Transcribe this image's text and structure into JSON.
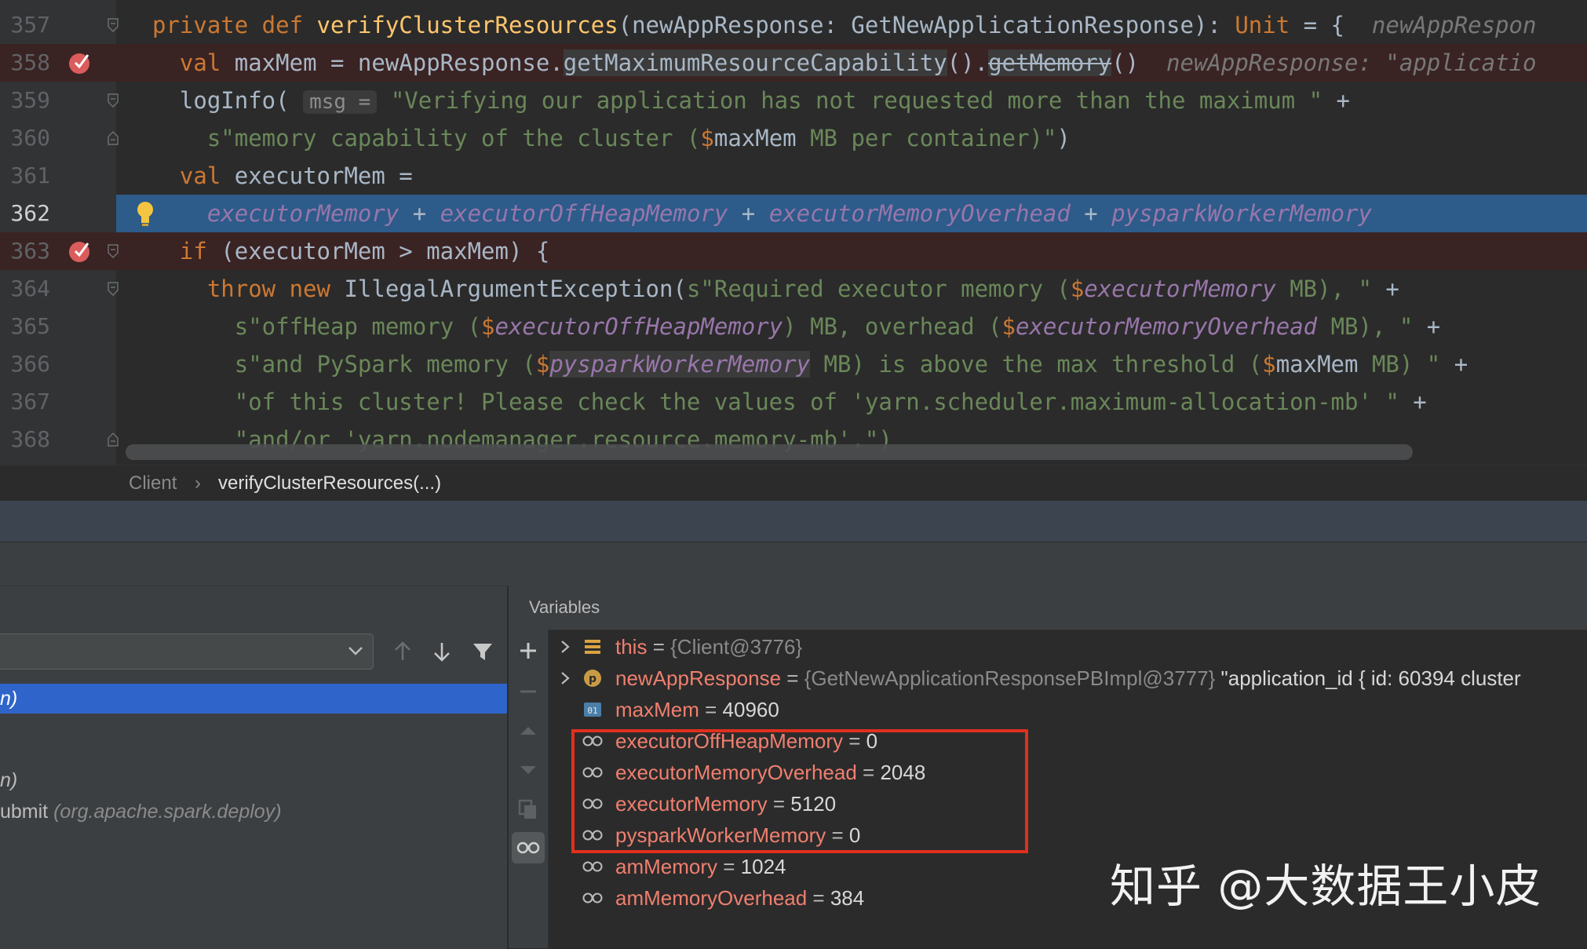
{
  "editor": {
    "lines": [
      {
        "num": "357",
        "parts": [
          {
            "t": "private def ",
            "c": "kw"
          },
          {
            "t": "verifyClusterResources",
            "c": "fn"
          },
          {
            "t": "(newAppResponse: GetNewApplicationResponse): "
          },
          {
            "t": "Unit",
            "c": "kw"
          },
          {
            "t": " = {  "
          },
          {
            "t": "newAppRespon",
            "c": "hint"
          }
        ]
      },
      {
        "num": "358",
        "parts": [
          {
            "t": "  "
          },
          {
            "t": "val ",
            "c": "kw"
          },
          {
            "t": "maxMem = newAppResponse."
          },
          {
            "t": "getMaximumResourceCapability",
            "c": "hl"
          },
          {
            "t": "()."
          },
          {
            "t": "getMemory",
            "c": "hl strike"
          },
          {
            "t": "()  "
          },
          {
            "t": "newAppResponse: \"applicatio",
            "c": "hint"
          }
        ]
      },
      {
        "num": "359",
        "parts": [
          {
            "t": "  logInfo( "
          },
          {
            "t": "msg =",
            "c": "param-hint"
          },
          {
            "t": " "
          },
          {
            "t": "\"Verifying our application has not requested more than the maximum \"",
            "c": "str"
          },
          {
            "t": " +"
          }
        ]
      },
      {
        "num": "360",
        "parts": [
          {
            "t": "    "
          },
          {
            "t": "s\"memory capability of the cluster (",
            "c": "str"
          },
          {
            "t": "$",
            "c": "dollar"
          },
          {
            "t": "maxMem"
          },
          {
            "t": " MB per container)\"",
            "c": "str"
          },
          {
            "t": ")"
          }
        ]
      },
      {
        "num": "361",
        "parts": [
          {
            "t": "  "
          },
          {
            "t": "val ",
            "c": "kw"
          },
          {
            "t": "executorMem ="
          }
        ]
      },
      {
        "num": "362",
        "parts": [
          {
            "t": "    "
          },
          {
            "t": "executorMemory",
            "c": "ivar"
          },
          {
            "t": " + "
          },
          {
            "t": "executorOffHeapMemory",
            "c": "ivar"
          },
          {
            "t": " + "
          },
          {
            "t": "executorMemoryOverhead",
            "c": "ivar"
          },
          {
            "t": " + "
          },
          {
            "t": "pysparkWorkerMemory",
            "c": "ivar"
          }
        ]
      },
      {
        "num": "363",
        "parts": [
          {
            "t": "  "
          },
          {
            "t": "if ",
            "c": "kw"
          },
          {
            "t": "(executorMem > maxMem) {"
          }
        ]
      },
      {
        "num": "364",
        "parts": [
          {
            "t": "    "
          },
          {
            "t": "throw new ",
            "c": "kw"
          },
          {
            "t": "IllegalArgumentException("
          },
          {
            "t": "s\"Required executor memory (",
            "c": "str"
          },
          {
            "t": "$",
            "c": "dollar"
          },
          {
            "t": "executorMemory",
            "c": "ivar"
          },
          {
            "t": " MB), \"",
            "c": "str"
          },
          {
            "t": " +"
          }
        ]
      },
      {
        "num": "365",
        "parts": [
          {
            "t": "      "
          },
          {
            "t": "s\"offHeap memory (",
            "c": "str"
          },
          {
            "t": "$",
            "c": "dollar"
          },
          {
            "t": "executorOffHeapMemory",
            "c": "ivar"
          },
          {
            "t": ") MB, overhead (",
            "c": "str"
          },
          {
            "t": "$",
            "c": "dollar"
          },
          {
            "t": "executorMemoryOverhead",
            "c": "ivar"
          },
          {
            "t": " MB), \"",
            "c": "str"
          },
          {
            "t": " +"
          }
        ]
      },
      {
        "num": "366",
        "parts": [
          {
            "t": "      "
          },
          {
            "t": "s\"and PySpark memory (",
            "c": "str"
          },
          {
            "t": "$",
            "c": "dollar"
          },
          {
            "t": "pysparkWorkerMemory",
            "c": "ivar hl"
          },
          {
            "t": " MB) is above the max threshold (",
            "c": "str"
          },
          {
            "t": "$",
            "c": "dollar"
          },
          {
            "t": "maxMem"
          },
          {
            "t": " MB) \"",
            "c": "str"
          },
          {
            "t": " +"
          }
        ]
      },
      {
        "num": "367",
        "parts": [
          {
            "t": "      "
          },
          {
            "t": "\"of this cluster! Please check the values of 'yarn.scheduler.maximum-allocation-mb' \"",
            "c": "str"
          },
          {
            "t": " +"
          }
        ]
      },
      {
        "num": "368",
        "parts": [
          {
            "t": "      "
          },
          {
            "t": "\"and/or 'yarn.nodemanager.resource.memory-mb'.\")",
            "c": "str"
          }
        ]
      }
    ]
  },
  "breadcrumb": {
    "first": "Client",
    "separator": "›",
    "second": "verifyClusterResources(...)"
  },
  "frames": {
    "items": [
      {
        "text": "n)",
        "pkg": "",
        "selected": true
      },
      {
        "text": "n)",
        "pkg": "",
        "selected": false
      },
      {
        "text": "ubmit ",
        "pkg": "(org.apache.spark.deploy)",
        "selected": false
      }
    ]
  },
  "variables": {
    "title": "Variables",
    "items": [
      {
        "name": "this",
        "eq": " = ",
        "value": "{Client@3776}",
        "valueStyle": "obj",
        "icon": "field-icon",
        "expandable": true
      },
      {
        "name": "newAppResponse",
        "eq": " = ",
        "value": "{GetNewApplicationResponsePBImpl@3777}",
        "valueStyle": "obj",
        "extra": " \"application_id { id: 60394 cluster",
        "icon": "parameter-icon",
        "expandable": true
      },
      {
        "name": "maxMem",
        "eq": " = ",
        "value": "40960",
        "valueStyle": "val",
        "icon": "primitive-icon",
        "expandable": false
      },
      {
        "name": "executorOffHeapMemory",
        "eq": " = ",
        "value": "0",
        "valueStyle": "val",
        "icon": "watch-icon",
        "expandable": false
      },
      {
        "name": "executorMemoryOverhead",
        "eq": " = ",
        "value": "2048",
        "valueStyle": "val",
        "icon": "watch-icon",
        "expandable": false
      },
      {
        "name": "executorMemory",
        "eq": " = ",
        "value": "5120",
        "valueStyle": "val",
        "icon": "watch-icon",
        "expandable": false
      },
      {
        "name": "pysparkWorkerMemory",
        "eq": " = ",
        "value": "0",
        "valueStyle": "val",
        "icon": "watch-icon",
        "expandable": false
      },
      {
        "name": "amMemory",
        "eq": " = ",
        "value": "1024",
        "valueStyle": "val",
        "icon": "watch-icon",
        "expandable": false
      },
      {
        "name": "amMemoryOverhead",
        "eq": " = ",
        "value": "384",
        "valueStyle": "val",
        "icon": "watch-icon",
        "expandable": false
      }
    ]
  },
  "watermark": "知乎 @大数据王小皮",
  "colors": {
    "keyword": "#cc7832",
    "function": "#ffc66d",
    "string": "#6a8759",
    "instance_var": "#9876aa",
    "execution_line": "#2d5b8a",
    "breakpoint_line": "#3a2323",
    "variable_name": "#f07f6f",
    "highlight_box": "#e0301e"
  }
}
